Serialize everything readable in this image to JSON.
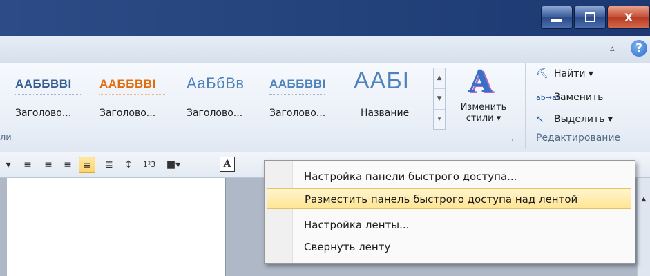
{
  "window": {
    "controls": {
      "minimize": "—",
      "maximize": "□",
      "close": "X"
    }
  },
  "tabstrip": {
    "help": "?"
  },
  "styles": {
    "items": [
      {
        "sample": "ААББВВІ",
        "label": "Заголово..."
      },
      {
        "sample": "ААББВВІ",
        "label": "Заголово..."
      },
      {
        "sample": "АаБбВв",
        "label": "Заголово..."
      },
      {
        "sample": "ААББВВІ",
        "label": "Заголово..."
      },
      {
        "sample": "ААБІ",
        "label": "Название"
      }
    ],
    "change_styles_line1": "Изменить",
    "change_styles_line2": "стили ▾",
    "group_label": "ли"
  },
  "editing": {
    "find": "Найти ▾",
    "replace": "Заменить",
    "select": "Выделить ▾",
    "group_label": "Редактирование"
  },
  "toolbar": {
    "font_color_letter": "A"
  },
  "context_menu": {
    "items": [
      {
        "label": "Настройка панели быстрого доступа..."
      },
      {
        "label": "Разместить панель быстрого доступа над лентой"
      },
      {
        "label": "Настройка ленты..."
      },
      {
        "label": "Свернуть ленту"
      }
    ]
  },
  "colors": {
    "titlebar": "#224079",
    "highlight": "#ffe592",
    "heading1": "#365f91",
    "heading2": "#e36c0a",
    "heading_blue": "#4f81bd"
  }
}
